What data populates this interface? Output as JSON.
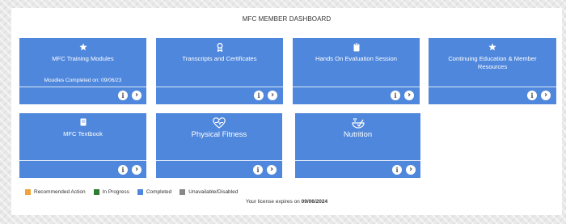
{
  "dashboard": {
    "title": "MFC MEMBER DASHBOARD",
    "tiles": [
      {
        "label": "MFC Training Modules",
        "icon": "star-icon",
        "sub": "Moudles Completed on: 09/06/23"
      },
      {
        "label": "Transcripts and Certificates",
        "icon": "award-icon"
      },
      {
        "label": "Hands On Evaluation Session",
        "icon": "clipboard-icon"
      },
      {
        "label": "Continuing Education & Member Resources",
        "icon": "star-icon"
      },
      {
        "label": "MFC Textbook",
        "icon": "book-icon"
      },
      {
        "label": "Physical Fitness",
        "icon": "heart-pulse-icon"
      },
      {
        "label": "Nutrition",
        "icon": "food-bowl-icon"
      }
    ],
    "info_glyph": "i",
    "arrow_glyph": "›"
  },
  "legend": [
    {
      "label": "Recommended Action",
      "color": "#f0a33a"
    },
    {
      "label": "In Progress",
      "color": "#2e7d32"
    },
    {
      "label": "Completed",
      "color": "#4f87dc"
    },
    {
      "label": "Unavailable/Disabled",
      "color": "#888888"
    }
  ],
  "license": {
    "prefix": "Your license expires on",
    "date": "09/06/2024"
  },
  "colors": {
    "tile": "#4f87dc",
    "panel": "#ffffff",
    "background": "#e9e9e9"
  }
}
